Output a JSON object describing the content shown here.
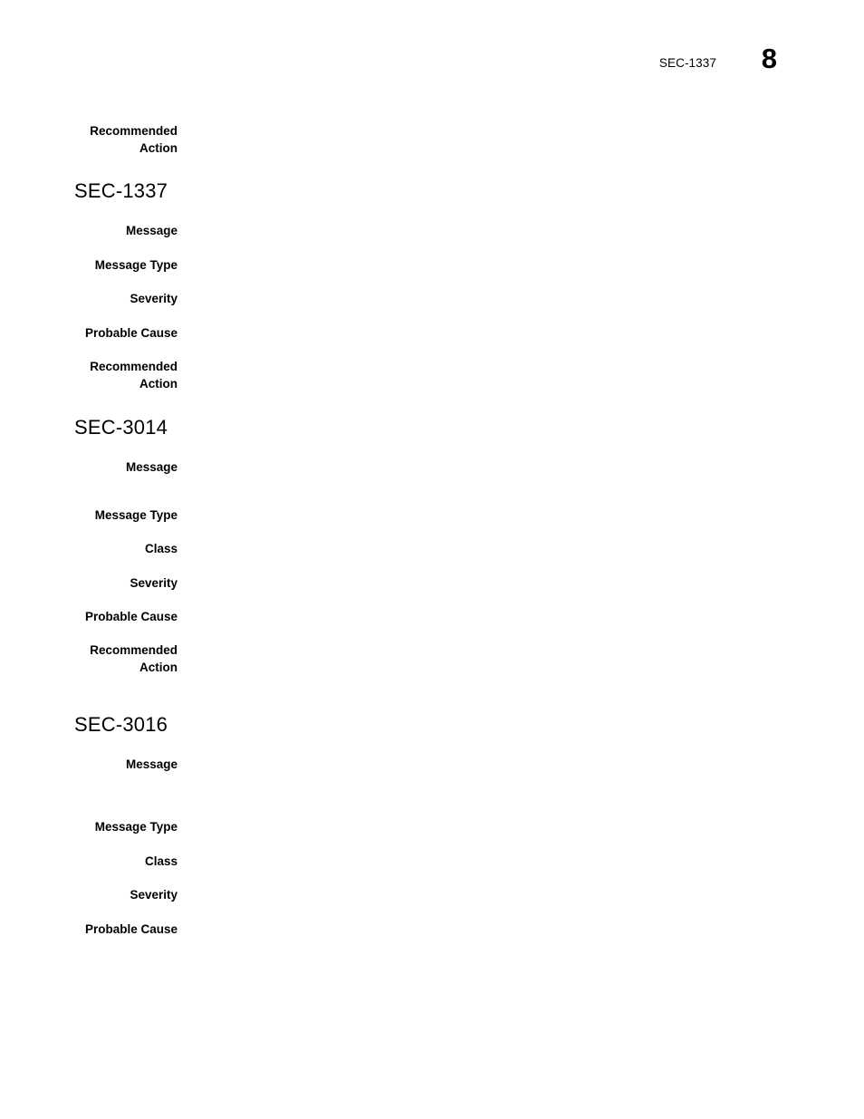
{
  "document": {
    "page_background": "#ffffff",
    "text_color": "#000000"
  },
  "header": {
    "chapter_label": "SEC-1337",
    "page_number": "8"
  },
  "continued_entry": {
    "label": "Recommended\nAction",
    "value": ""
  },
  "sections": [
    {
      "heading": "SEC-1337",
      "entries": [
        {
          "label": "Message",
          "value": ""
        },
        {
          "label": "Message Type",
          "value": ""
        },
        {
          "label": "Severity",
          "value": ""
        },
        {
          "label": "Probable Cause",
          "value": ""
        },
        {
          "label": "Recommended\nAction",
          "value": ""
        }
      ]
    },
    {
      "heading": "SEC-3014",
      "entries": [
        {
          "label": "Message",
          "value": ""
        },
        {
          "label": "Message Type",
          "value": ""
        },
        {
          "label": "Class",
          "value": ""
        },
        {
          "label": "Severity",
          "value": ""
        },
        {
          "label": "Probable Cause",
          "value": ""
        },
        {
          "label": "Recommended\nAction",
          "value": ""
        }
      ]
    },
    {
      "heading": "SEC-3016",
      "entries": [
        {
          "label": "Message",
          "value": ""
        },
        {
          "label": "Message Type",
          "value": ""
        },
        {
          "label": "Class",
          "value": ""
        },
        {
          "label": "Severity",
          "value": ""
        },
        {
          "label": "Probable Cause",
          "value": ""
        }
      ]
    }
  ]
}
